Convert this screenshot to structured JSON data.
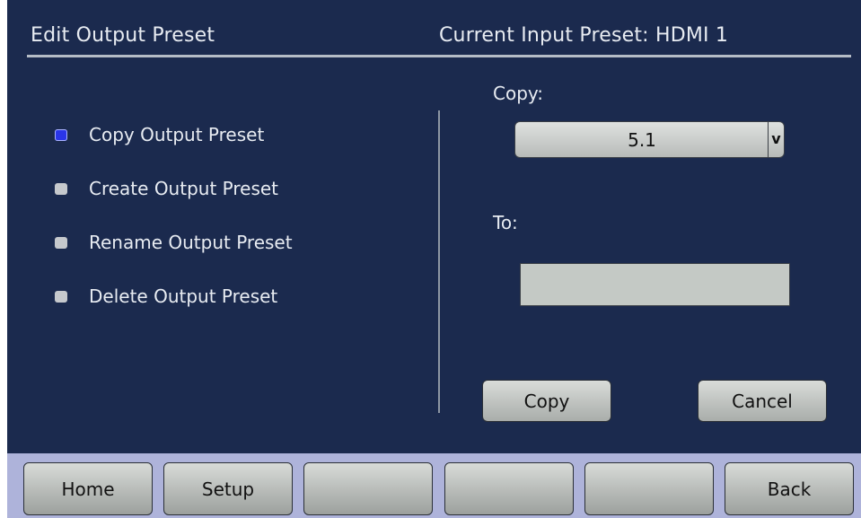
{
  "header": {
    "title": "Edit Output Preset",
    "current_input": "Current Input Preset: HDMI 1"
  },
  "options": [
    {
      "label": "Copy Output Preset",
      "selected": true
    },
    {
      "label": "Create Output Preset",
      "selected": false
    },
    {
      "label": "Rename Output Preset",
      "selected": false
    },
    {
      "label": "Delete Output Preset",
      "selected": false
    }
  ],
  "form": {
    "copy_label": "Copy:",
    "copy_value": "5.1",
    "dropdown_arrow": "v",
    "to_label": "To:",
    "to_value": "",
    "copy_button": "Copy",
    "cancel_button": "Cancel"
  },
  "nav": {
    "buttons": [
      "Home",
      "Setup",
      "",
      "",
      "",
      "Back"
    ]
  },
  "colors": {
    "background": "#1b2a4e",
    "selected_indicator": "#2a35e8",
    "nav_bar": "#aeb3da"
  }
}
